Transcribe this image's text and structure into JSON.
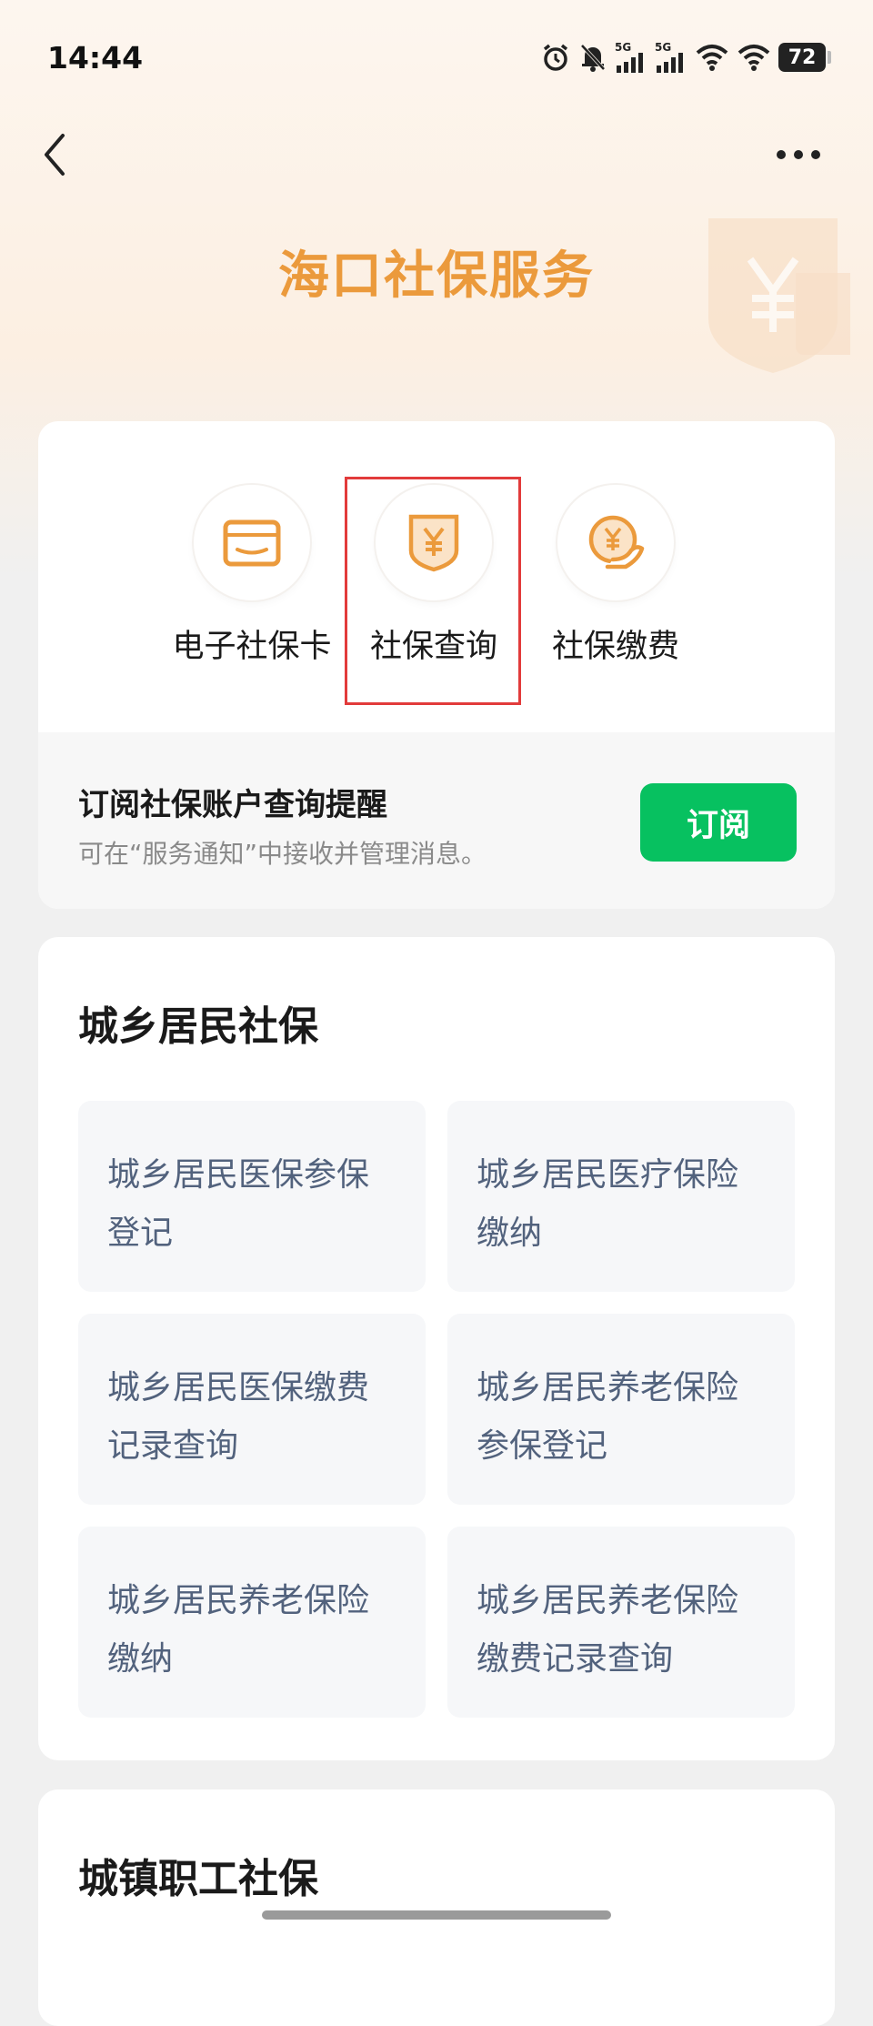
{
  "status_bar": {
    "time": "14:44",
    "network_1": "5G",
    "network_2": "5G",
    "battery": "72"
  },
  "nav": {
    "back_icon": "chevron-left-icon",
    "more_icon": "more-dots-icon"
  },
  "header": {
    "title": "海口社保服务",
    "decoration_icon": "yen-shield-icon"
  },
  "services": [
    {
      "label": "电子社保卡",
      "icon": "card-icon"
    },
    {
      "label": "社保查询",
      "icon": "yen-shield-icon",
      "highlighted": true
    },
    {
      "label": "社保缴费",
      "icon": "yen-hand-icon"
    }
  ],
  "subscribe": {
    "title": "订阅社保账户查询提醒",
    "description": "可在“服务通知”中接收并管理消息。",
    "button_label": "订阅"
  },
  "sections": [
    {
      "title": "城乡居民社保",
      "items": [
        {
          "line1": "城乡居民医保参保",
          "line2": "登记"
        },
        {
          "line1": "城乡居民医疗保险",
          "line2": "缴纳"
        },
        {
          "line1": "城乡居民医保缴费",
          "line2": "记录查询"
        },
        {
          "line1": "城乡居民养老保险",
          "line2": "参保登记"
        },
        {
          "line1": "城乡居民养老保险",
          "line2": "缴纳"
        },
        {
          "line1": "城乡居民养老保险",
          "line2": "缴费记录查询"
        }
      ]
    },
    {
      "title": "城镇职工社保"
    }
  ],
  "colors": {
    "accent_orange": "#eb9a3c",
    "primary_green": "#07c160",
    "highlight_red": "#e23b3b",
    "tile_text": "#52627d"
  }
}
